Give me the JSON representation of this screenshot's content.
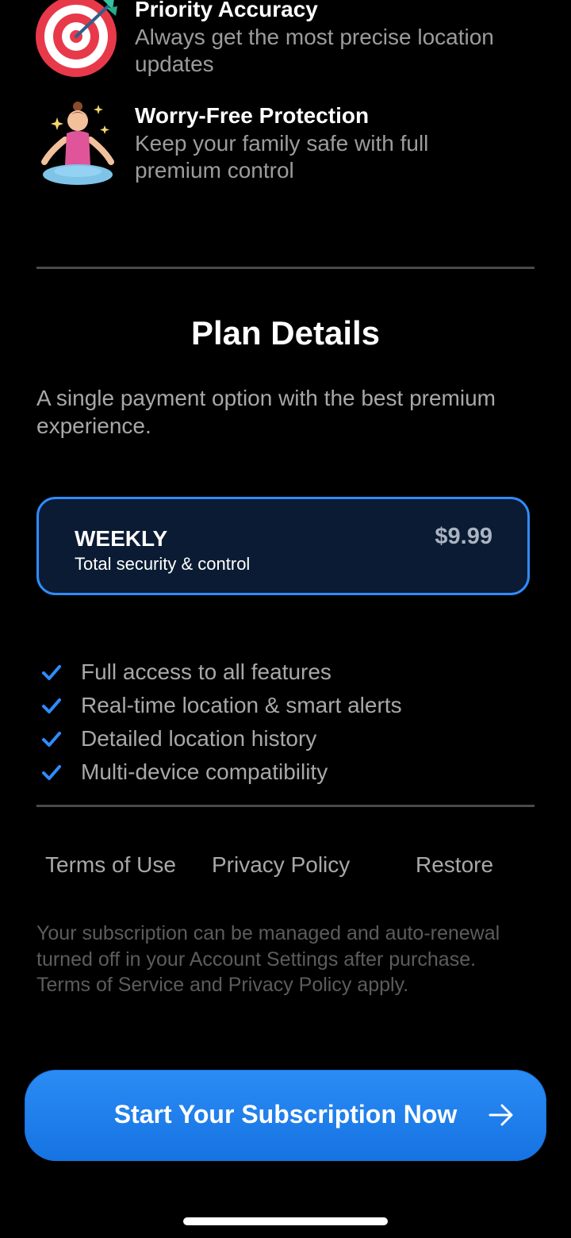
{
  "features": [
    {
      "title": "Priority Accuracy",
      "description": "Always get the most precise location updates",
      "icon": "target-icon"
    },
    {
      "title": "Worry-Free Protection",
      "description": "Keep your family safe with full premium control",
      "icon": "meditation-icon"
    }
  ],
  "plan_section": {
    "heading": "Plan Details",
    "subtitle": "A single payment option with the best premium experience."
  },
  "plan": {
    "name": "WEEKLY",
    "tagline": "Total security & control",
    "price": "$9.99",
    "selected": true
  },
  "benefits": [
    "Full access to all features",
    "Real-time location & smart alerts",
    "Detailed location history",
    "Multi-device compatibility"
  ],
  "links": {
    "terms": "Terms of Use",
    "privacy": "Privacy Policy",
    "restore": "Restore"
  },
  "legal_text": "Your subscription can be managed and auto-renewal turned off in your Account Settings after purchase. Terms of Service and Privacy Policy apply.",
  "cta": {
    "label": "Start Your Subscription Now",
    "icon": "arrow-right-icon"
  },
  "colors": {
    "background": "#000000",
    "accent": "#2f8cff",
    "card_bg": "#0b1b33",
    "check": "#2f8cff",
    "button": "#1f7fec"
  }
}
